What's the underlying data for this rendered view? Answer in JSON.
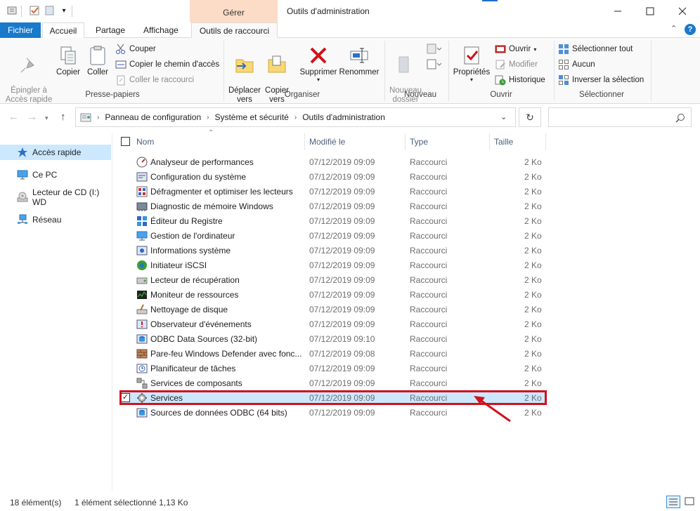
{
  "window": {
    "title": "Outils d'administration",
    "context_tab": "Gérer",
    "controls": [
      "minimize",
      "maximize",
      "close"
    ]
  },
  "ribbon_tabs": [
    "Fichier",
    "Accueil",
    "Partage",
    "Affichage",
    "Outils de raccourci"
  ],
  "ribbon": {
    "clipboard": {
      "pin": "Épingler à\nAccès rapide",
      "copy": "Copier",
      "paste": "Coller",
      "cut": "Couper",
      "copy_path": "Copier le chemin d'accès",
      "paste_shortcut": "Coller le raccourci",
      "label": "Presse-papiers"
    },
    "organize": {
      "move": "Déplacer\nvers",
      "copy_to": "Copier\nvers",
      "delete": "Supprimer",
      "rename": "Renommer",
      "label": "Organiser"
    },
    "new": {
      "new_folder": "Nouveau\ndossier",
      "label": "Nouveau"
    },
    "open": {
      "properties": "Propriétés",
      "open": "Ouvrir",
      "edit": "Modifier",
      "history": "Historique",
      "label": "Ouvrir"
    },
    "select": {
      "select_all": "Sélectionner tout",
      "none": "Aucun",
      "invert": "Inverser la sélection",
      "label": "Sélectionner"
    }
  },
  "address": {
    "breadcrumb": [
      "Panneau de configuration",
      "Système et sécurité",
      "Outils d'administration"
    ],
    "search_placeholder": ""
  },
  "sidebar": {
    "items": [
      "Accès rapide",
      "Ce PC",
      "Lecteur de CD (I:) WD",
      "Réseau"
    ]
  },
  "columns": [
    "Nom",
    "Modifié le",
    "Type",
    "Taille"
  ],
  "files": [
    {
      "name": "Analyseur de performances",
      "date": "07/12/2019 09:09",
      "type": "Raccourci",
      "size": "2 Ko"
    },
    {
      "name": "Configuration du système",
      "date": "07/12/2019 09:09",
      "type": "Raccourci",
      "size": "2 Ko"
    },
    {
      "name": "Défragmenter et optimiser les lecteurs",
      "date": "07/12/2019 09:09",
      "type": "Raccourci",
      "size": "2 Ko"
    },
    {
      "name": "Diagnostic de mémoire Windows",
      "date": "07/12/2019 09:09",
      "type": "Raccourci",
      "size": "2 Ko"
    },
    {
      "name": "Éditeur du Registre",
      "date": "07/12/2019 09:09",
      "type": "Raccourci",
      "size": "2 Ko"
    },
    {
      "name": "Gestion de l'ordinateur",
      "date": "07/12/2019 09:09",
      "type": "Raccourci",
      "size": "2 Ko"
    },
    {
      "name": "Informations système",
      "date": "07/12/2019 09:09",
      "type": "Raccourci",
      "size": "2 Ko"
    },
    {
      "name": "Initiateur iSCSI",
      "date": "07/12/2019 09:09",
      "type": "Raccourci",
      "size": "2 Ko"
    },
    {
      "name": "Lecteur de récupération",
      "date": "07/12/2019 09:09",
      "type": "Raccourci",
      "size": "2 Ko"
    },
    {
      "name": "Moniteur de ressources",
      "date": "07/12/2019 09:09",
      "type": "Raccourci",
      "size": "2 Ko"
    },
    {
      "name": "Nettoyage de disque",
      "date": "07/12/2019 09:09",
      "type": "Raccourci",
      "size": "2 Ko"
    },
    {
      "name": "Observateur d'événements",
      "date": "07/12/2019 09:09",
      "type": "Raccourci",
      "size": "2 Ko"
    },
    {
      "name": "ODBC Data Sources (32-bit)",
      "date": "07/12/2019 09:10",
      "type": "Raccourci",
      "size": "2 Ko"
    },
    {
      "name": "Pare-feu Windows Defender avec fonc...",
      "date": "07/12/2019 09:08",
      "type": "Raccourci",
      "size": "2 Ko"
    },
    {
      "name": "Planificateur de tâches",
      "date": "07/12/2019 09:09",
      "type": "Raccourci",
      "size": "2 Ko"
    },
    {
      "name": "Services de composants",
      "date": "07/12/2019 09:09",
      "type": "Raccourci",
      "size": "2 Ko"
    },
    {
      "name": "Services",
      "date": "07/12/2019 09:09",
      "type": "Raccourci",
      "size": "2 Ko",
      "selected": true
    },
    {
      "name": "Sources de données ODBC (64 bits)",
      "date": "07/12/2019 09:09",
      "type": "Raccourci",
      "size": "2 Ko"
    }
  ],
  "status": {
    "count": "18 élément(s)",
    "selection": "1 élément sélectionné 1,13 Ko"
  },
  "colors": {
    "accent": "#1979ca",
    "selection": "#cce8ff",
    "highlight_box": "#d1121a",
    "context_tab": "#fcdcc6"
  }
}
